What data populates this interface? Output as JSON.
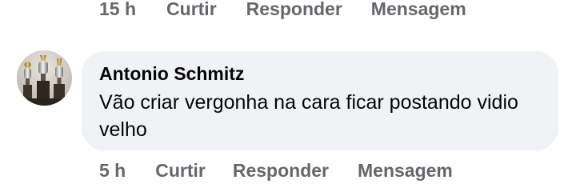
{
  "previous_comment": {
    "time": "15 h",
    "like_label": "Curtir",
    "reply_label": "Responder",
    "message_label": "Mensagem"
  },
  "comment": {
    "author": "Antonio Schmitz",
    "text": "Vão criar vergonha na cara ficar postando vidio velho",
    "avatar_icon": "trophy-cups-photo",
    "time": "5 h",
    "like_label": "Curtir",
    "reply_label": "Responder",
    "message_label": "Mensagem"
  },
  "colors": {
    "bubble_bg": "#f0f2f5",
    "text": "#050505",
    "meta": "#65676b"
  }
}
